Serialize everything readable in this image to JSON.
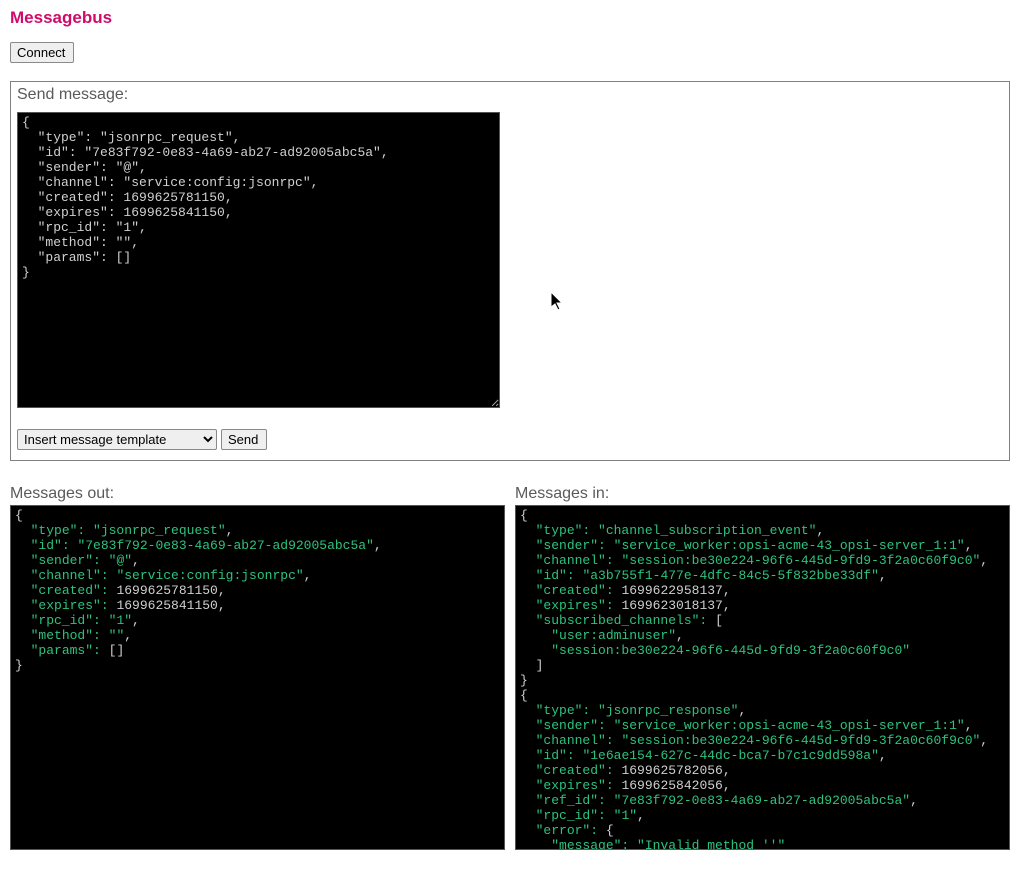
{
  "title": "Messagebus",
  "connect_label": "Connect",
  "send_panel": {
    "legend": "Send message:",
    "textarea_value": "{\n  \"type\": \"jsonrpc_request\",\n  \"id\": \"7e83f792-0e83-4a69-ab27-ad92005abc5a\",\n  \"sender\": \"@\",\n  \"channel\": \"service:config:jsonrpc\",\n  \"created\": 1699625781150,\n  \"expires\": 1699625841150,\n  \"rpc_id\": \"1\",\n  \"method\": \"\",\n  \"params\": []\n}",
    "template_select_label": "Insert message template",
    "send_label": "Send"
  },
  "messages_out": {
    "label": "Messages out:",
    "json": {
      "type": "jsonrpc_request",
      "id": "7e83f792-0e83-4a69-ab27-ad92005abc5a",
      "sender": "@",
      "channel": "service:config:jsonrpc",
      "created": 1699625781150,
      "expires": 1699625841150,
      "rpc_id": "1",
      "method": "",
      "params": []
    }
  },
  "messages_in": {
    "label": "Messages in:",
    "json": [
      {
        "type": "channel_subscription_event",
        "sender": "service_worker:opsi-acme-43_opsi-server_1:1",
        "channel": "session:be30e224-96f6-445d-9fd9-3f2a0c60f9c0",
        "id": "a3b755f1-477e-4dfc-84c5-5f832bbe33df",
        "created": 1699622958137,
        "expires": 1699623018137,
        "subscribed_channels": [
          "user:adminuser",
          "session:be30e224-96f6-445d-9fd9-3f2a0c60f9c0"
        ]
      },
      {
        "type": "jsonrpc_response",
        "sender": "service_worker:opsi-acme-43_opsi-server_1:1",
        "channel": "session:be30e224-96f6-445d-9fd9-3f2a0c60f9c0",
        "id": "1e6ae154-627c-44dc-bca7-b7c1c9dd598a",
        "created": 1699625782056,
        "expires": 1699625842056,
        "ref_id": "7e83f792-0e83-4a69-ab27-ad92005abc5a",
        "rpc_id": "1",
        "error": {
          "message": "Invalid method ''"
        }
      }
    ]
  }
}
